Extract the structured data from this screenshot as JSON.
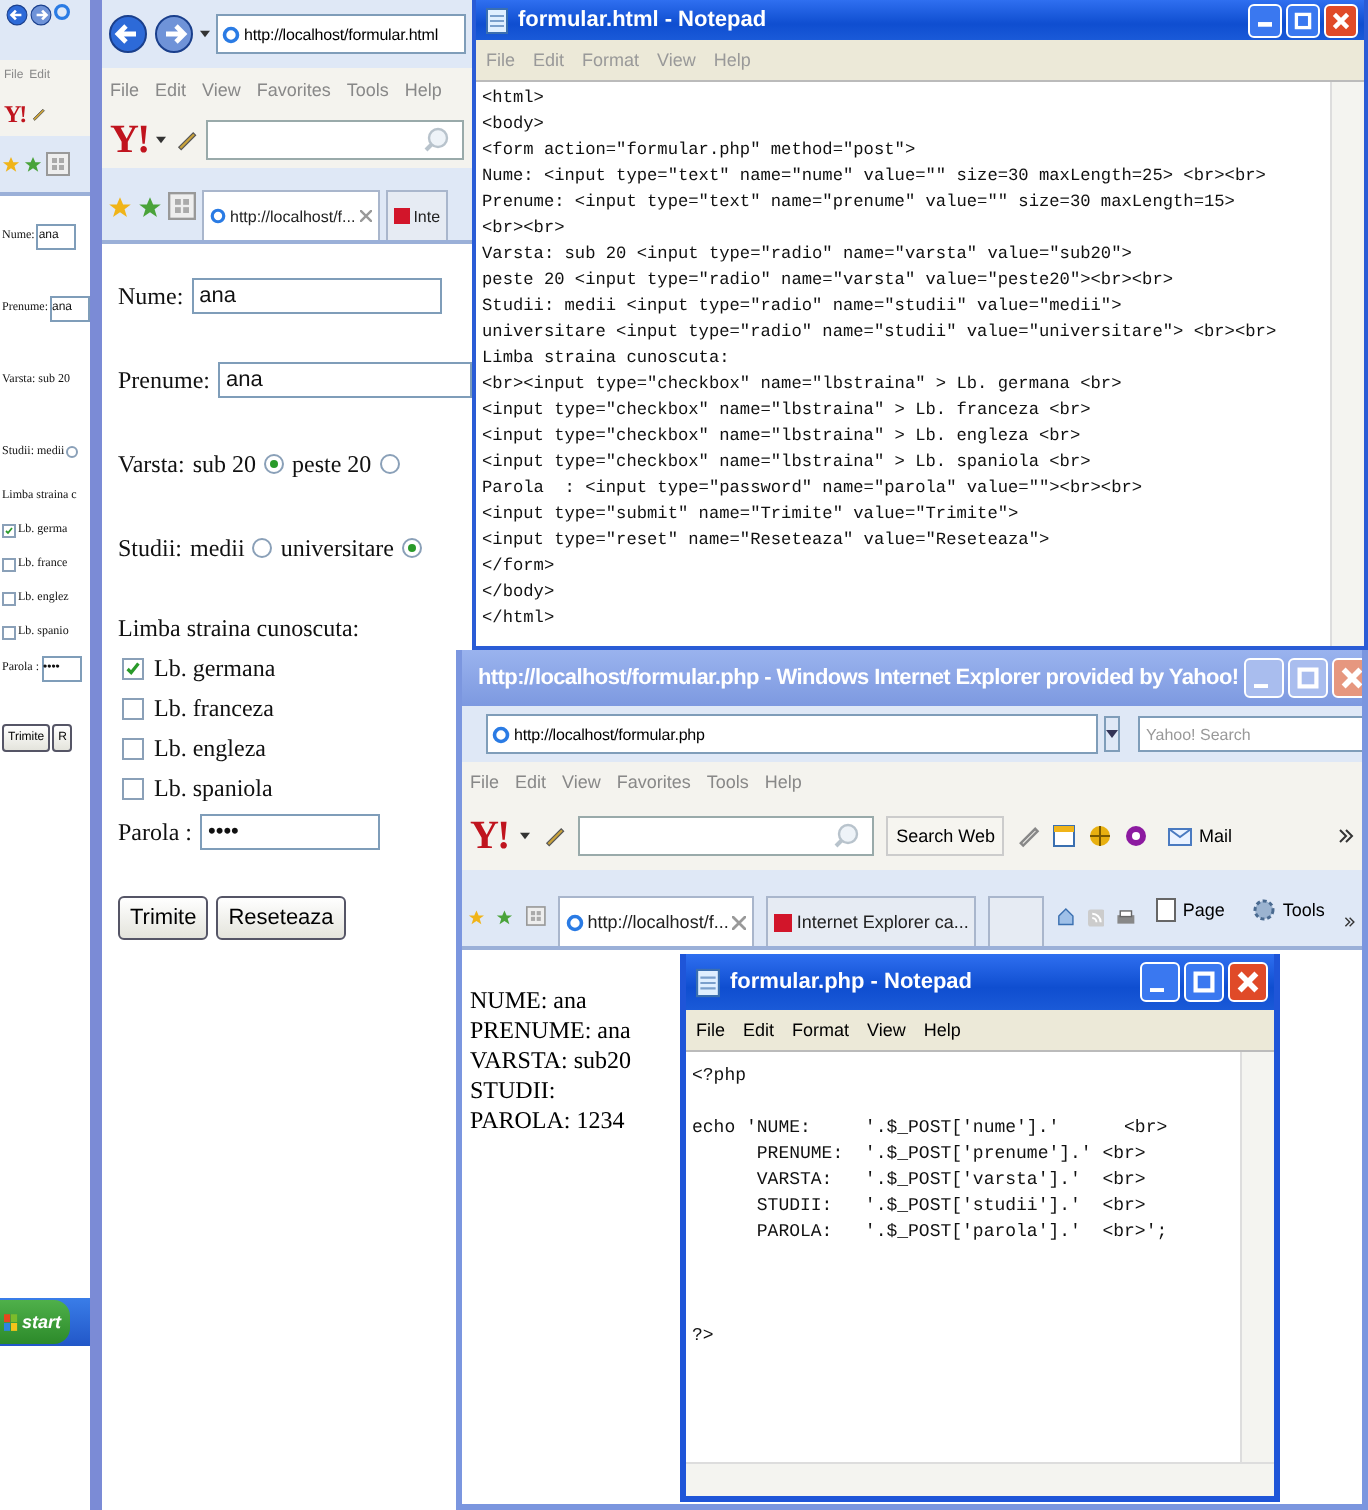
{
  "left_window": {
    "menu": [
      "File",
      "Edit"
    ],
    "logo": "Y!",
    "lines": [
      {
        "kind": "field",
        "label": "Nume:",
        "value": "ana"
      },
      {
        "kind": "field",
        "label": "Prenume:",
        "value": "ana"
      },
      {
        "kind": "text",
        "text": "Varsta: sub 20"
      },
      {
        "kind": "radio",
        "text": "Studii: medii",
        "selected": false
      },
      {
        "kind": "heading",
        "text": "Limba straina c"
      },
      {
        "kind": "checkbox",
        "text": "Lb. germa",
        "checked": true
      },
      {
        "kind": "checkbox",
        "text": "Lb. france",
        "checked": false
      },
      {
        "kind": "checkbox",
        "text": "Lb. englez",
        "checked": false
      },
      {
        "kind": "checkbox",
        "text": "Lb. spanio",
        "checked": false
      },
      {
        "kind": "field",
        "label": "Parola :",
        "value": "••••"
      },
      {
        "kind": "buttons",
        "labels": [
          "Trimite",
          "R"
        ]
      }
    ],
    "start": "start"
  },
  "form_browser": {
    "address": "http://localhost/formular.html",
    "menu": [
      "File",
      "Edit",
      "View",
      "Favorites",
      "Tools",
      "Help"
    ],
    "logo": "Y!",
    "tabs": [
      {
        "label": "http://localhost/f...",
        "selected": true
      },
      {
        "label": "Inte",
        "selected": false
      }
    ],
    "lines": [
      {
        "kind": "field",
        "label": "Nume:",
        "value": "ana"
      },
      {
        "kind": "field",
        "label": "Prenume:",
        "value": "ana"
      },
      {
        "kind": "radio_group",
        "label": "Varsta:",
        "options": [
          {
            "label": "sub 20",
            "selected": true
          },
          {
            "label": "peste 20",
            "selected": false
          }
        ]
      },
      {
        "kind": "radio_group",
        "label": "Studii:",
        "options": [
          {
            "label": "medii",
            "selected": false
          },
          {
            "label": "universitare",
            "selected": true
          }
        ]
      },
      {
        "kind": "heading",
        "text": "Limba straina cunoscuta:"
      },
      {
        "kind": "checkbox",
        "text": "Lb. germana",
        "checked": true
      },
      {
        "kind": "checkbox",
        "text": "Lb. franceza",
        "checked": false
      },
      {
        "kind": "checkbox",
        "text": "Lb. engleza",
        "checked": false
      },
      {
        "kind": "checkbox",
        "text": "Lb. spaniola",
        "checked": false
      },
      {
        "kind": "field",
        "label": "Parola :",
        "value": "••••"
      },
      {
        "kind": "buttons",
        "labels": [
          "Trimite",
          "Reseteaza"
        ]
      }
    ]
  },
  "html_notepad": {
    "title": "formular.html - Notepad",
    "menu": [
      "File",
      "Edit",
      "Format",
      "View",
      "Help"
    ],
    "text": "<html>\n<body>\n<form action=\"formular.php\" method=\"post\">\nNume: <input type=\"text\" name=\"nume\" value=\"\" size=30 maxLength=25> <br><br>\nPrenume: <input type=\"text\" name=\"prenume\" value=\"\" size=30 maxLength=15>\n<br><br>\nVarsta: sub 20 <input type=\"radio\" name=\"varsta\" value=\"sub20\">\npeste 20 <input type=\"radio\" name=\"varsta\" value=\"peste20\"><br><br>\nStudii: medii <input type=\"radio\" name=\"studii\" value=\"medii\">\nuniversitare <input type=\"radio\" name=\"studii\" value=\"universitare\"> <br><br>\nLimba straina cunoscuta:\n<br><input type=\"checkbox\" name=\"lbstraina\" > Lb. germana <br>\n<input type=\"checkbox\" name=\"lbstraina\" > Lb. franceza <br>\n<input type=\"checkbox\" name=\"lbstraina\" > Lb. engleza <br>\n<input type=\"checkbox\" name=\"lbstraina\" > Lb. spaniola <br>\nParola  : <input type=\"password\" name=\"parola\" value=\"\"><br><br>\n<input type=\"submit\" name=\"Trimite\" value=\"Trimite\">\n<input type=\"reset\" name=\"Reseteaza\" value=\"Reseteaza\">\n</form>\n</body>\n</html>"
  },
  "php_browser": {
    "title": "http://localhost/formular.php - Windows Internet Explorer provided by Yahoo!",
    "address": "http://localhost/formular.php",
    "search_placeholder": "Yahoo! Search",
    "menu": [
      "File",
      "Edit",
      "View",
      "Favorites",
      "Tools",
      "Help"
    ],
    "logo": "Y!",
    "search_button": "Search Web",
    "mail": "Mail",
    "tabs": [
      {
        "label": "http://localhost/f...",
        "selected": true
      },
      {
        "label": "Internet Explorer ca...",
        "selected": false
      }
    ],
    "commands": [
      "Page",
      "Tools"
    ],
    "output": [
      "NUME: ana",
      "PRENUME: ana",
      "VARSTA: sub20",
      "STUDII:",
      "PAROLA: 1234"
    ]
  },
  "php_notepad": {
    "title": "formular.php - Notepad",
    "menu": [
      "File",
      "Edit",
      "Format",
      "View",
      "Help"
    ],
    "text": "<?php\n\necho 'NUME:     '.$_POST['nume'].'      <br>\n      PRENUME:  '.$_POST['prenume'].' <br>\n      VARSTA:   '.$_POST['varsta'].'  <br>\n      STUDII:   '.$_POST['studii'].'  <br>\n      PAROLA:   '.$_POST['parola'].'  <br>';\n\n\n\n?>"
  }
}
